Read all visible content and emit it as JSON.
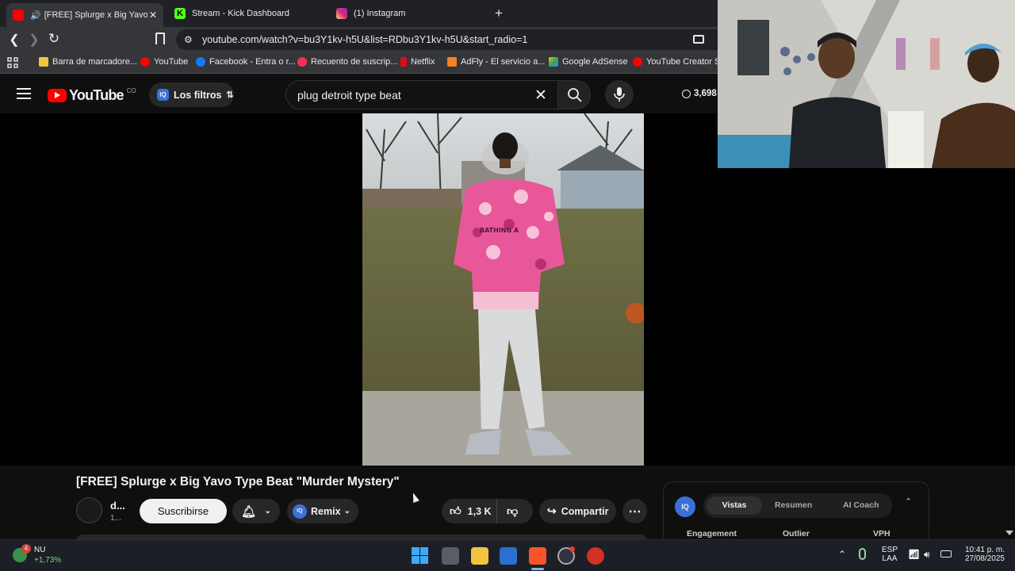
{
  "tabs": [
    {
      "title": "[FREE] Splurge x Big Yavo Typ",
      "active": true
    },
    {
      "title": "Stream - Kick Dashboard",
      "active": false
    },
    {
      "title": "(1) Instagram",
      "active": false
    }
  ],
  "new_tab": "+",
  "address": {
    "url": "youtube.com/watch?v=bu3Y1kv-h5U&list=RDbu3Y1kv-h5U&start_radio=1"
  },
  "bookmarks": [
    {
      "label": "Barra de marcadore...",
      "icon": "folder-icon",
      "color": "#f4c542"
    },
    {
      "label": "YouTube",
      "icon": "youtube-icon",
      "color": "#ff0000"
    },
    {
      "label": "Facebook - Entra o r...",
      "icon": "facebook-icon",
      "color": "#1877f2"
    },
    {
      "label": "Recuento de suscrip...",
      "icon": "youtube-icon",
      "color": "#ff2d55"
    },
    {
      "label": "Netflix",
      "icon": "netflix-icon",
      "color": "#e50914"
    },
    {
      "label": "AdFly - El servicio a...",
      "icon": "adfly-icon",
      "color": "#f58220"
    },
    {
      "label": "Google AdSense",
      "icon": "adsense-icon",
      "color": "#fbbc04"
    },
    {
      "label": "YouTube Creator St...",
      "icon": "youtube-icon",
      "color": "#ff0000"
    }
  ],
  "youtube": {
    "logo_text": "YouTube",
    "country": "CO",
    "filters_label": "Los filtros",
    "search_query": "plug detroit type beat",
    "counter": "3,698"
  },
  "video": {
    "title": "[FREE] Splurge x Big Yavo Type Beat \"Murder Mystery\"",
    "channel_name": "d...",
    "channel_subs": "1...",
    "subscribe_label": "Suscribirse",
    "remix_label": "Remix",
    "likes": "1,3 K",
    "share_label": "Compartir",
    "hoodie_text": "BATHING A"
  },
  "iq_panel": {
    "tabs": [
      "Vistas",
      "Resumen",
      "AI Coach"
    ],
    "columns": [
      "Engagement",
      "Outlier",
      "VPH"
    ]
  },
  "taskbar": {
    "weather_badge": "4",
    "stock_name": "NU",
    "stock_change": "+1,73%",
    "lang_top": "ESP",
    "lang_bottom": "LAA",
    "time": "10:41 p. m.",
    "date": "27/08/2025"
  },
  "colors": {
    "yt_red": "#ff0000",
    "iq_blue": "#3b6fd9",
    "chrome_dark": "#202124",
    "chrome_toolbar": "#35363a"
  }
}
